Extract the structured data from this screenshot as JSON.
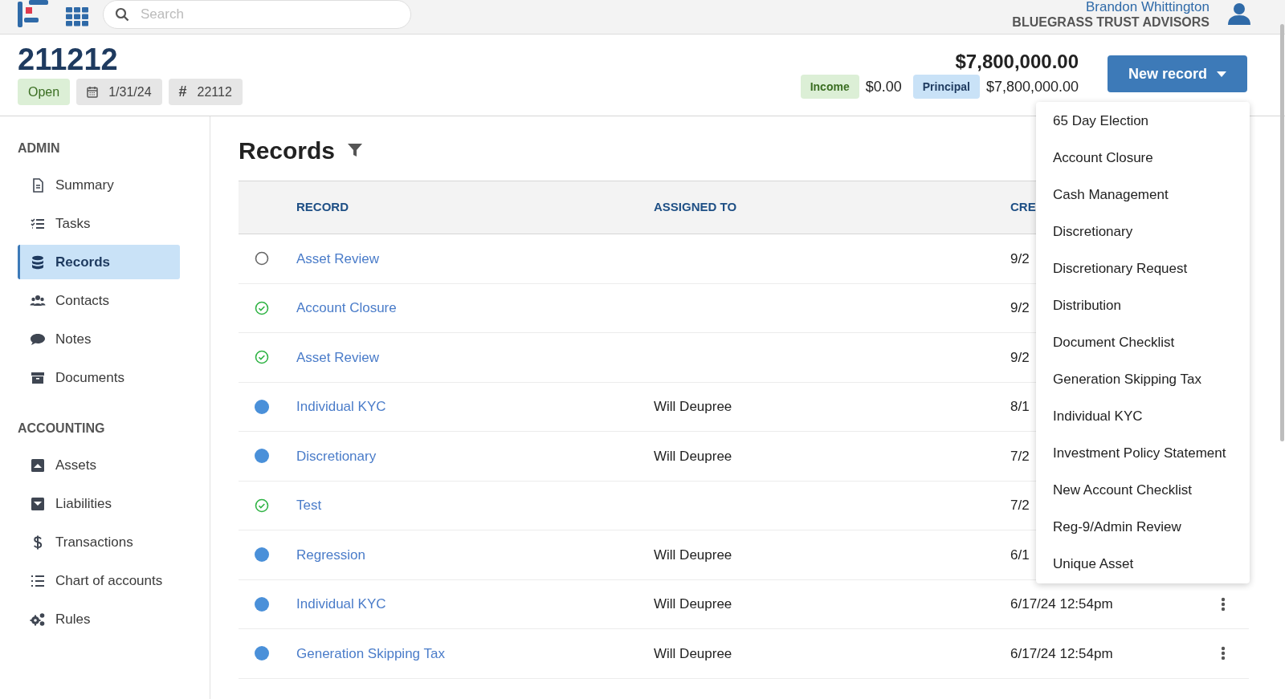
{
  "top_bar": {
    "search": {
      "placeholder": "Search"
    },
    "user": {
      "name": "Brandon Whittington",
      "organization": "BLUEGRASS TRUST ADVISORS"
    }
  },
  "header": {
    "title": "211212",
    "status": "Open",
    "date": "1/31/24",
    "number_symbol": "#",
    "number": "22112",
    "total": "$7,800,000.00",
    "balances": [
      {
        "label": "Income",
        "amount": "$0.00",
        "kind": "income"
      },
      {
        "label": "Principal",
        "amount": "$7,800,000.00",
        "kind": "principal"
      }
    ],
    "new_record_button": {
      "label": "New record"
    }
  },
  "sidebar": {
    "sections": [
      {
        "title": "ADMIN",
        "items": [
          {
            "label": "Summary",
            "selected": false
          },
          {
            "label": "Tasks",
            "selected": false
          },
          {
            "label": "Records",
            "selected": true
          },
          {
            "label": "Contacts",
            "selected": false
          },
          {
            "label": "Notes",
            "selected": false
          },
          {
            "label": "Documents",
            "selected": false
          }
        ]
      },
      {
        "title": "ACCOUNTING",
        "items": [
          {
            "label": "Assets",
            "selected": false
          },
          {
            "label": "Liabilities",
            "selected": false
          },
          {
            "label": "Transactions",
            "selected": false
          },
          {
            "label": "Chart of accounts",
            "selected": false
          },
          {
            "label": "Rules",
            "selected": false
          }
        ]
      }
    ]
  },
  "records": {
    "title": "Records",
    "table": {
      "columns": [
        "RECORD",
        "ASSIGNED TO",
        "CRE"
      ],
      "rows": [
        {
          "kind": "open",
          "record": "Asset Review",
          "created": "9/2"
        },
        {
          "kind": "done",
          "record": "Account Closure",
          "created": "9/2"
        },
        {
          "kind": "done",
          "record": "Asset Review",
          "created": "9/2"
        },
        {
          "kind": "active",
          "record": "Individual KYC",
          "assigned_to": "Will Deupree",
          "created": "8/1"
        },
        {
          "kind": "active",
          "record": "Discretionary",
          "assigned_to": "Will Deupree",
          "created": "7/2"
        },
        {
          "kind": "done",
          "record": "Test",
          "created": "7/2"
        },
        {
          "kind": "active",
          "record": "Regression",
          "assigned_to": "Will Deupree",
          "created": "6/1"
        },
        {
          "kind": "active",
          "record": "Individual KYC",
          "assigned_to": "Will Deupree",
          "created": "6/17/24 12:54pm"
        },
        {
          "kind": "active",
          "record": "Generation Skipping Tax",
          "assigned_to": "Will Deupree",
          "created": "6/17/24 12:54pm"
        }
      ]
    }
  },
  "new_record_menu": [
    "65 Day Election",
    "Account Closure",
    "Cash Management",
    "Discretionary",
    "Discretionary Request",
    "Distribution",
    "Document Checklist",
    "Generation Skipping Tax",
    "Individual KYC",
    "Investment Policy Statement",
    "New Account Checklist",
    "Reg-9/Admin Review",
    "Unique Asset"
  ]
}
